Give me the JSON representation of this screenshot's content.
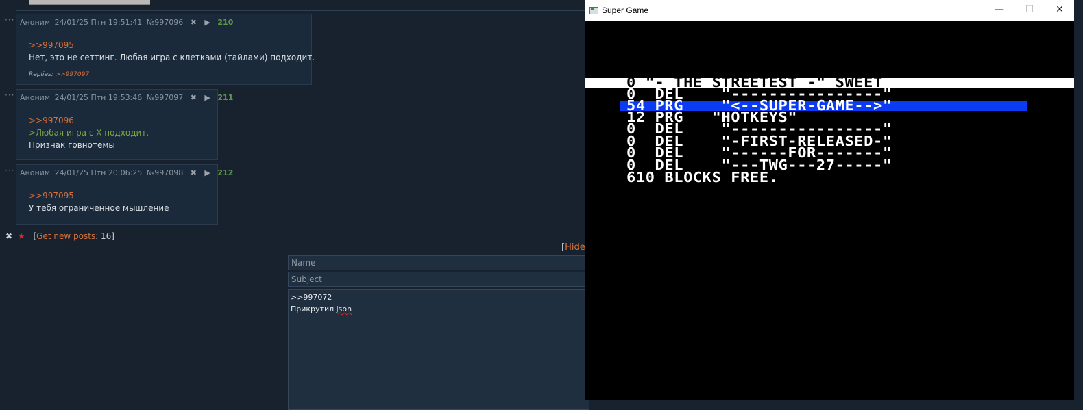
{
  "posts": [
    {
      "author": "Аноним",
      "date": "24/01/25 Птн 19:51:41",
      "id": "№997096",
      "number": "210",
      "reply_to": ">>997095",
      "lines": [
        "Нет, это не сеттинг. Любая игра с клетками (тайлами) подходит."
      ],
      "replies_label": "Replies:",
      "replies": ">>997097"
    },
    {
      "author": "Аноним",
      "date": "24/01/25 Птн 19:53:46",
      "id": "№997097",
      "number": "211",
      "reply_to": ">>997096",
      "quote": ">Любая игра с X подходит.",
      "lines": [
        "Признак говнотемы"
      ]
    },
    {
      "author": "Аноним",
      "date": "24/01/25 Птн 20:06:25",
      "id": "№997098",
      "number": "212",
      "reply_to": ">>997095",
      "lines": [
        "У тебя ограниченное мышление"
      ]
    }
  ],
  "new_posts": {
    "open_bracket": "[",
    "label": "Get new posts",
    "count": ": 16]"
  },
  "hide": {
    "open_bracket": "[",
    "label": "Hide"
  },
  "form": {
    "name_placeholder": "Name",
    "subject_placeholder": "Subject",
    "message_line1": ">>997072",
    "message_word": "Прикрутил ",
    "message_misspelled": "json"
  },
  "window": {
    "title": "Super Game",
    "controls": {
      "minimize": "—",
      "maximize": "☐",
      "close": "✕"
    }
  },
  "c64_listing": [
    "0 \"- THE STREETEST -\" SWEET",
    "0  DEL    \"----------------\"",
    "54 PRG    \"<--SUPER-GAME-->\"",
    "12 PRG   \"HOTKEYS\"",
    "0  DEL    \"----------------\"",
    "0  DEL    \"-FIRST-RELEASED-\"",
    "0  DEL    \"------FOR-------\"",
    "0  DEL    \"---TWG---27-----\"",
    "610 BLOCKS FREE."
  ],
  "colors": {
    "forum_bg": "#17222e",
    "post_bg": "#1b2a3a",
    "link": "#d8703a",
    "quote": "#78a73f",
    "post_number": "#5c9a4a",
    "c64_highlight": "#0b3cf2"
  }
}
